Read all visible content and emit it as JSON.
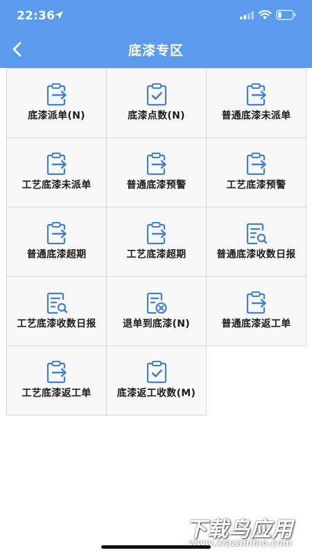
{
  "status_bar": {
    "time": "22:36",
    "icons": [
      "location-arrow-icon",
      "signal-icon",
      "wifi-icon",
      "battery-icon"
    ]
  },
  "nav": {
    "title": "底漆专区",
    "back_icon": "chevron-left-icon"
  },
  "colors": {
    "header_bg": "#5a9bed",
    "icon_blue": "#3d7fd4",
    "cell_bg": "#f8f8f8",
    "cell_border": "#d7d7d7"
  },
  "grid": {
    "items": [
      {
        "label": "底漆派单(N)",
        "icon": "clipboard-arrow-icon"
      },
      {
        "label": "底漆点数(N)",
        "icon": "clipboard-check-icon"
      },
      {
        "label": "普通底漆未派单",
        "icon": "clipboard-arrow-icon"
      },
      {
        "label": "工艺底漆未派单",
        "icon": "clipboard-arrow-icon"
      },
      {
        "label": "普通底漆预警",
        "icon": "clipboard-arrow-icon"
      },
      {
        "label": "工艺底漆预警",
        "icon": "clipboard-arrow-icon"
      },
      {
        "label": "普通底漆超期",
        "icon": "clipboard-arrow-icon"
      },
      {
        "label": "工艺底漆超期",
        "icon": "clipboard-arrow-icon"
      },
      {
        "label": "普通底漆收数日报",
        "icon": "report-search-icon"
      },
      {
        "label": "工艺底漆收数日报",
        "icon": "report-search-icon"
      },
      {
        "label": "退单到底漆(N)",
        "icon": "document-cancel-icon"
      },
      {
        "label": "普通底漆返工单",
        "icon": "clipboard-arrow-icon"
      },
      {
        "label": "工艺底漆返工单",
        "icon": "clipboard-arrow-icon"
      },
      {
        "label": "底漆返工收数(M)",
        "icon": "clipboard-check-icon"
      }
    ]
  },
  "watermark": {
    "main": "下载鸟应用",
    "sub": "www.xiazainiao.com"
  }
}
